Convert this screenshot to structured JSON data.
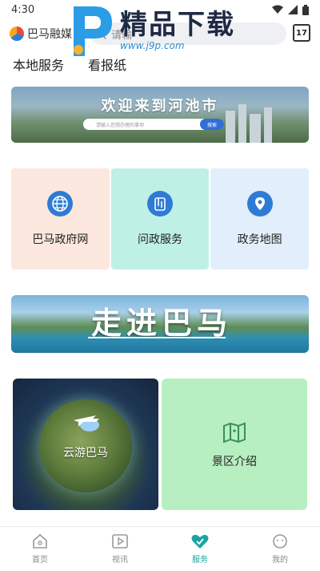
{
  "status_bar": {
    "time": "4:30"
  },
  "header": {
    "logo_text": "巴马融媒",
    "search_placeholder": "请输",
    "calendar_day": "17"
  },
  "watermark": {
    "title": "精品下载",
    "url": "www.j9p.com"
  },
  "tabs": [
    {
      "label": "本地服务"
    },
    {
      "label": "看报纸"
    }
  ],
  "banner_welcome": {
    "title": "欢迎来到河池市",
    "search_placeholder": "请输入您想办理的事项",
    "search_button": "搜索"
  },
  "services": [
    {
      "label": "巴马政府网",
      "icon": "globe-icon",
      "bg": "#fbe7dd"
    },
    {
      "label": "问政服务",
      "icon": "inquiry-icon",
      "bg": "#bff0e6"
    },
    {
      "label": "政务地图",
      "icon": "map-pin-icon",
      "bg": "#e2eefb"
    }
  ],
  "banner_zoujin": {
    "title": "走进巴马"
  },
  "tour": {
    "label": "云游巴马"
  },
  "scenic": {
    "label": "景区介绍"
  },
  "bottom_nav": [
    {
      "label": "首页",
      "icon": "home-icon",
      "active": false
    },
    {
      "label": "视讯",
      "icon": "video-icon",
      "active": false
    },
    {
      "label": "服务",
      "icon": "heart-service-icon",
      "active": true
    },
    {
      "label": "我的",
      "icon": "profile-icon",
      "active": false
    }
  ],
  "colors": {
    "accent": "#1aa4a4",
    "service_icon": "#2e7bd6",
    "scenic_bg": "#b7efc1"
  }
}
